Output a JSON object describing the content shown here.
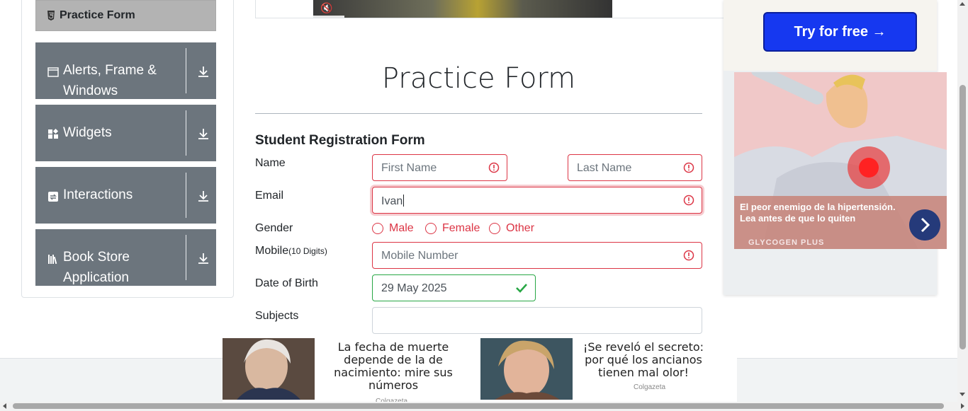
{
  "sidebar": {
    "active_item": {
      "label": "Practice Form",
      "icon": "html5-icon"
    },
    "groups": [
      {
        "label": "Alerts, Frame & Windows",
        "icon": "window-icon"
      },
      {
        "label": "Widgets",
        "icon": "widgets-icon"
      },
      {
        "label": "Interactions",
        "icon": "interactions-icon"
      },
      {
        "label": "Book Store Application",
        "icon": "books-icon"
      }
    ]
  },
  "main": {
    "page_title": "Practice Form",
    "form_title": "Student Registration Form",
    "labels": {
      "name": "Name",
      "email": "Email",
      "gender": "Gender",
      "mobile": "Mobile",
      "mobile_hint": "(10 Digits)",
      "dob": "Date of Birth",
      "subjects": "Subjects"
    },
    "fields": {
      "first_name_placeholder": "First Name",
      "last_name_placeholder": "Last Name",
      "email_value": "Ivan",
      "mobile_placeholder": "Mobile Number",
      "dob_value": "29 May 2025"
    },
    "gender_options": [
      "Male",
      "Female",
      "Other"
    ]
  },
  "ads": {
    "right": {
      "button": "Try for free →",
      "caption": "El peor enemigo de la hipertensión. Lea antes de que lo quiten",
      "brand": "GLYCOGEN PLUS"
    },
    "bottom": [
      {
        "text": "La fecha de muerte depende de la de nacimiento: mire sus números",
        "source": "Colgazeta"
      },
      {
        "text": "¡Se reveló el secreto: por qué los ancianos tienen mal olor!",
        "source": "Colgazeta"
      }
    ]
  },
  "colors": {
    "invalid": "#dc3545",
    "valid": "#28a745",
    "sidebar_group": "#6c757d",
    "ad_button": "#1638f0"
  }
}
